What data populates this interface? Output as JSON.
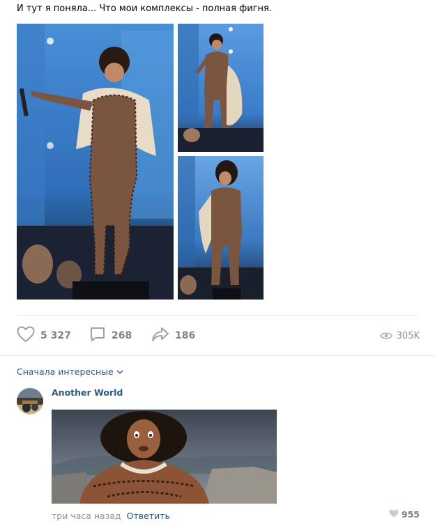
{
  "post": {
    "text": "И тут я поняла... Что мои комплексы - полная фигня."
  },
  "actions": {
    "likes": "5 327",
    "comments": "268",
    "shares": "186",
    "views": "305K"
  },
  "comments_section": {
    "sort_label": "Сначала интересные"
  },
  "comment": {
    "author": "Another World",
    "time": "три часа назад",
    "reply_label": "Ответить",
    "likes": "955"
  },
  "icons": {
    "like": "heart-icon",
    "comment": "comment-bubble-icon",
    "share": "share-arrow-icon",
    "views": "eye-icon",
    "sort": "chevron-down-icon"
  },
  "colors": {
    "link": "#2a5885",
    "muted": "#828282",
    "divider": "#e7e8ec"
  }
}
